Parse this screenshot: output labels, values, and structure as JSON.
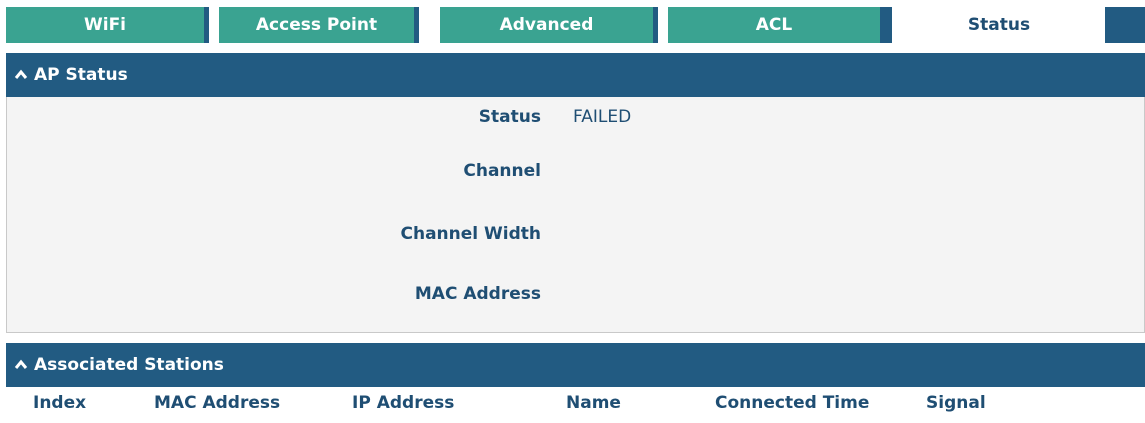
{
  "tabs": [
    {
      "label": "WiFi"
    },
    {
      "label": "Access Point"
    },
    {
      "label": "Advanced"
    },
    {
      "label": "ACL"
    },
    {
      "label": "Status"
    }
  ],
  "ap_status": {
    "title": "AP Status",
    "fields": [
      {
        "label": "Status",
        "value": "FAILED"
      },
      {
        "label": "Channel",
        "value": ""
      },
      {
        "label": "Channel Width",
        "value": ""
      },
      {
        "label": "MAC Address",
        "value": ""
      }
    ]
  },
  "stations": {
    "title": "Associated Stations",
    "columns": [
      "Index",
      "MAC Address",
      "IP Address",
      "Name",
      "Connected Time",
      "Signal"
    ]
  },
  "colors": {
    "tab": "#3aa391",
    "header": "#225b82",
    "text": "#1f4e73"
  }
}
